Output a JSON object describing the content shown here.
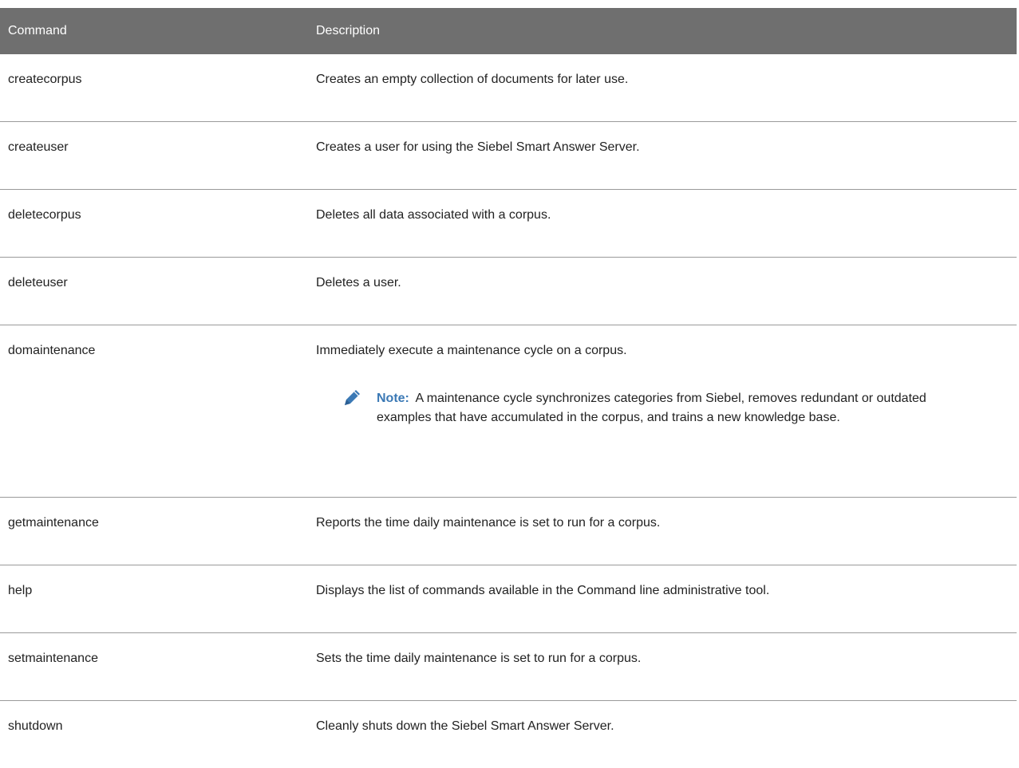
{
  "header": {
    "command": "Command",
    "description": "Description"
  },
  "rows": [
    {
      "command": "createcorpus",
      "description": "Creates an empty collection of documents for later use."
    },
    {
      "command": "createuser",
      "description": "Creates a user for using the Siebel Smart Answer Server."
    },
    {
      "command": "deletecorpus",
      "description": "Deletes all data associated with a corpus."
    },
    {
      "command": "deleteuser",
      "description": "Deletes a user."
    },
    {
      "command": "domaintenance",
      "description": "Immediately execute a maintenance cycle on a corpus.",
      "note": {
        "label": "Note:",
        "icon": "pencil-icon",
        "text": "A maintenance cycle synchronizes categories from Siebel, removes redundant or outdated examples that have accumulated in the corpus, and trains a new knowledge base."
      }
    },
    {
      "command": "getmaintenance",
      "description": "Reports the time daily maintenance is set to run for a corpus."
    },
    {
      "command": "help",
      "description": "Displays the list of commands available in the Command line administrative tool."
    },
    {
      "command": "setmaintenance",
      "description": "Sets the time daily maintenance is set to run for a corpus."
    },
    {
      "command": "shutdown",
      "description": "Cleanly shuts down the Siebel Smart Answer Server."
    }
  ],
  "colors": {
    "header_bg": "#6f6f6f",
    "note_label": "#3b79b5",
    "icon": "#3b79b5"
  }
}
